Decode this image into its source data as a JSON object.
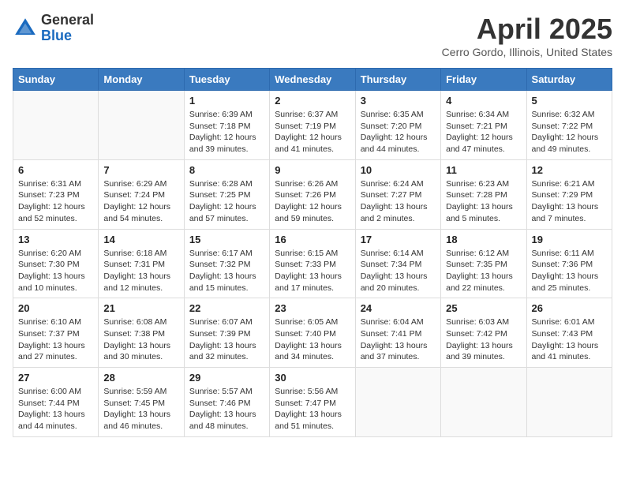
{
  "header": {
    "logo_general": "General",
    "logo_blue": "Blue",
    "title": "April 2025",
    "subtitle": "Cerro Gordo, Illinois, United States"
  },
  "days_of_week": [
    "Sunday",
    "Monday",
    "Tuesday",
    "Wednesday",
    "Thursday",
    "Friday",
    "Saturday"
  ],
  "weeks": [
    [
      {
        "day": "",
        "info": ""
      },
      {
        "day": "",
        "info": ""
      },
      {
        "day": "1",
        "info": "Sunrise: 6:39 AM\nSunset: 7:18 PM\nDaylight: 12 hours and 39 minutes."
      },
      {
        "day": "2",
        "info": "Sunrise: 6:37 AM\nSunset: 7:19 PM\nDaylight: 12 hours and 41 minutes."
      },
      {
        "day": "3",
        "info": "Sunrise: 6:35 AM\nSunset: 7:20 PM\nDaylight: 12 hours and 44 minutes."
      },
      {
        "day": "4",
        "info": "Sunrise: 6:34 AM\nSunset: 7:21 PM\nDaylight: 12 hours and 47 minutes."
      },
      {
        "day": "5",
        "info": "Sunrise: 6:32 AM\nSunset: 7:22 PM\nDaylight: 12 hours and 49 minutes."
      }
    ],
    [
      {
        "day": "6",
        "info": "Sunrise: 6:31 AM\nSunset: 7:23 PM\nDaylight: 12 hours and 52 minutes."
      },
      {
        "day": "7",
        "info": "Sunrise: 6:29 AM\nSunset: 7:24 PM\nDaylight: 12 hours and 54 minutes."
      },
      {
        "day": "8",
        "info": "Sunrise: 6:28 AM\nSunset: 7:25 PM\nDaylight: 12 hours and 57 minutes."
      },
      {
        "day": "9",
        "info": "Sunrise: 6:26 AM\nSunset: 7:26 PM\nDaylight: 12 hours and 59 minutes."
      },
      {
        "day": "10",
        "info": "Sunrise: 6:24 AM\nSunset: 7:27 PM\nDaylight: 13 hours and 2 minutes."
      },
      {
        "day": "11",
        "info": "Sunrise: 6:23 AM\nSunset: 7:28 PM\nDaylight: 13 hours and 5 minutes."
      },
      {
        "day": "12",
        "info": "Sunrise: 6:21 AM\nSunset: 7:29 PM\nDaylight: 13 hours and 7 minutes."
      }
    ],
    [
      {
        "day": "13",
        "info": "Sunrise: 6:20 AM\nSunset: 7:30 PM\nDaylight: 13 hours and 10 minutes."
      },
      {
        "day": "14",
        "info": "Sunrise: 6:18 AM\nSunset: 7:31 PM\nDaylight: 13 hours and 12 minutes."
      },
      {
        "day": "15",
        "info": "Sunrise: 6:17 AM\nSunset: 7:32 PM\nDaylight: 13 hours and 15 minutes."
      },
      {
        "day": "16",
        "info": "Sunrise: 6:15 AM\nSunset: 7:33 PM\nDaylight: 13 hours and 17 minutes."
      },
      {
        "day": "17",
        "info": "Sunrise: 6:14 AM\nSunset: 7:34 PM\nDaylight: 13 hours and 20 minutes."
      },
      {
        "day": "18",
        "info": "Sunrise: 6:12 AM\nSunset: 7:35 PM\nDaylight: 13 hours and 22 minutes."
      },
      {
        "day": "19",
        "info": "Sunrise: 6:11 AM\nSunset: 7:36 PM\nDaylight: 13 hours and 25 minutes."
      }
    ],
    [
      {
        "day": "20",
        "info": "Sunrise: 6:10 AM\nSunset: 7:37 PM\nDaylight: 13 hours and 27 minutes."
      },
      {
        "day": "21",
        "info": "Sunrise: 6:08 AM\nSunset: 7:38 PM\nDaylight: 13 hours and 30 minutes."
      },
      {
        "day": "22",
        "info": "Sunrise: 6:07 AM\nSunset: 7:39 PM\nDaylight: 13 hours and 32 minutes."
      },
      {
        "day": "23",
        "info": "Sunrise: 6:05 AM\nSunset: 7:40 PM\nDaylight: 13 hours and 34 minutes."
      },
      {
        "day": "24",
        "info": "Sunrise: 6:04 AM\nSunset: 7:41 PM\nDaylight: 13 hours and 37 minutes."
      },
      {
        "day": "25",
        "info": "Sunrise: 6:03 AM\nSunset: 7:42 PM\nDaylight: 13 hours and 39 minutes."
      },
      {
        "day": "26",
        "info": "Sunrise: 6:01 AM\nSunset: 7:43 PM\nDaylight: 13 hours and 41 minutes."
      }
    ],
    [
      {
        "day": "27",
        "info": "Sunrise: 6:00 AM\nSunset: 7:44 PM\nDaylight: 13 hours and 44 minutes."
      },
      {
        "day": "28",
        "info": "Sunrise: 5:59 AM\nSunset: 7:45 PM\nDaylight: 13 hours and 46 minutes."
      },
      {
        "day": "29",
        "info": "Sunrise: 5:57 AM\nSunset: 7:46 PM\nDaylight: 13 hours and 48 minutes."
      },
      {
        "day": "30",
        "info": "Sunrise: 5:56 AM\nSunset: 7:47 PM\nDaylight: 13 hours and 51 minutes."
      },
      {
        "day": "",
        "info": ""
      },
      {
        "day": "",
        "info": ""
      },
      {
        "day": "",
        "info": ""
      }
    ]
  ]
}
